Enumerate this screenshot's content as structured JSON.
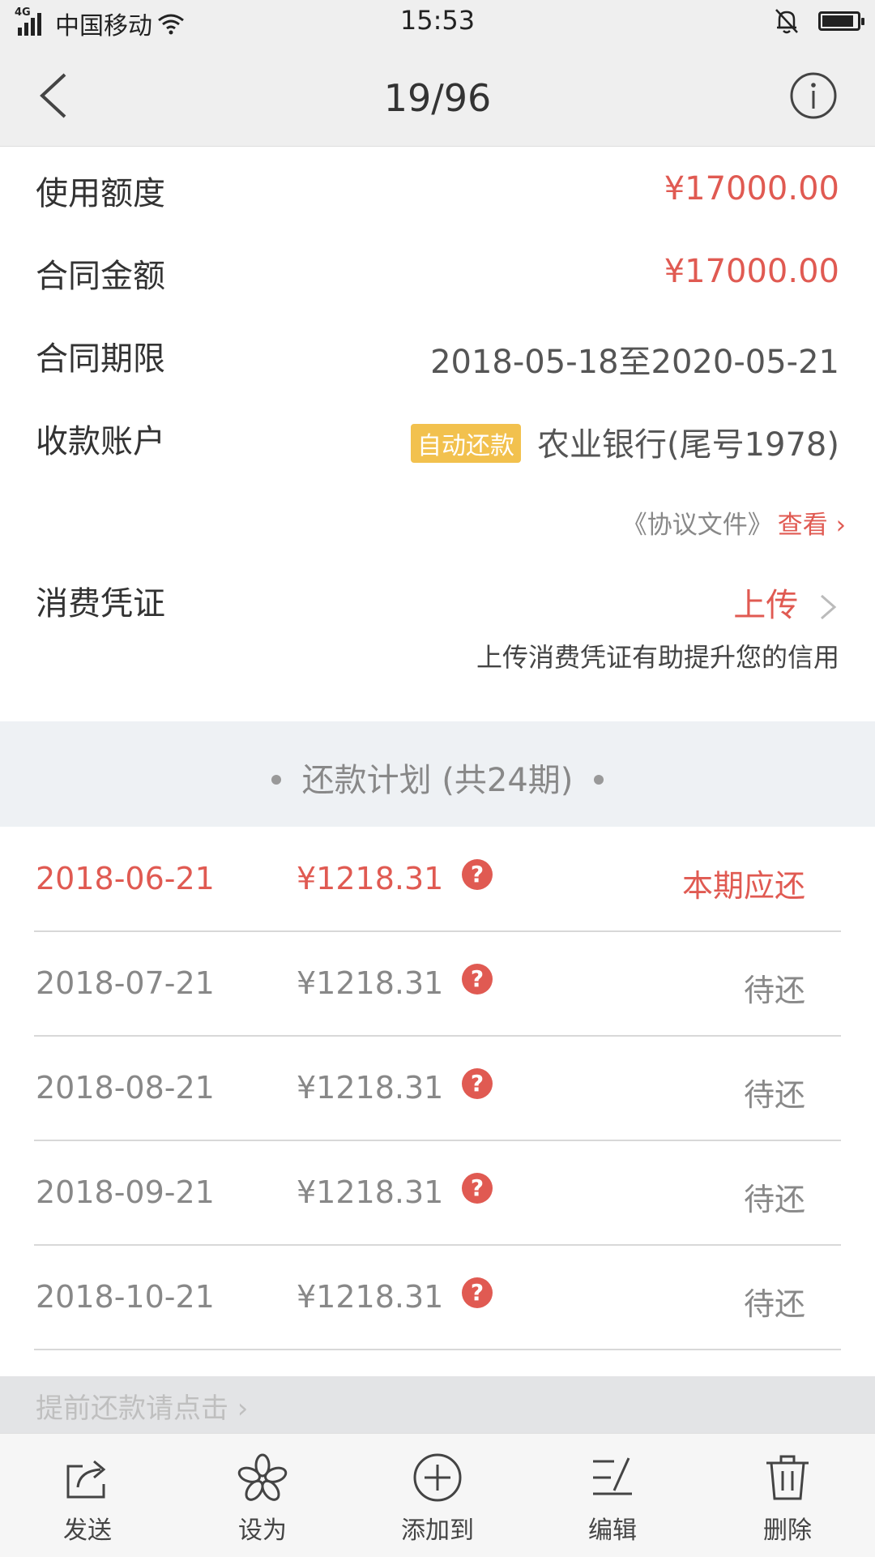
{
  "status_bar": {
    "network": "4G",
    "carrier": "中国移动",
    "time": "15:53"
  },
  "header": {
    "title": "19/96"
  },
  "details": {
    "credit_label": "使用额度",
    "credit_value": "¥17000.00",
    "contract_amount_label": "合同金额",
    "contract_amount_value": "¥17000.00",
    "term_label": "合同期限",
    "term_value": "2018-05-18至2020-05-21",
    "account_label": "收款账户",
    "account_tag": "自动还款",
    "account_value": "农业银行(尾号1978)",
    "agreement_text": "《协议文件》",
    "agreement_link": "查看 ›",
    "voucher_label": "消费凭证",
    "voucher_action": "上传",
    "voucher_hint": "上传消费凭证有助提升您的信用"
  },
  "plan": {
    "title": "还款计划 (共24期)",
    "help_icon": "?",
    "installments": [
      {
        "date": "2018-06-21",
        "amount": "¥1218.31",
        "status": "本期应还"
      },
      {
        "date": "2018-07-21",
        "amount": "¥1218.31",
        "status": "待还"
      },
      {
        "date": "2018-08-21",
        "amount": "¥1218.31",
        "status": "待还"
      },
      {
        "date": "2018-09-21",
        "amount": "¥1218.31",
        "status": "待还"
      },
      {
        "date": "2018-10-21",
        "amount": "¥1218.31",
        "status": "待还"
      }
    ]
  },
  "prepay": {
    "label": "提前还款请点击 ›"
  },
  "toolbar": {
    "send": "发送",
    "set_as": "设为",
    "add_to": "添加到",
    "edit": "编辑",
    "delete": "删除"
  },
  "colors": {
    "accent_red": "#e05a52",
    "tag_yellow": "#f2c14e"
  }
}
